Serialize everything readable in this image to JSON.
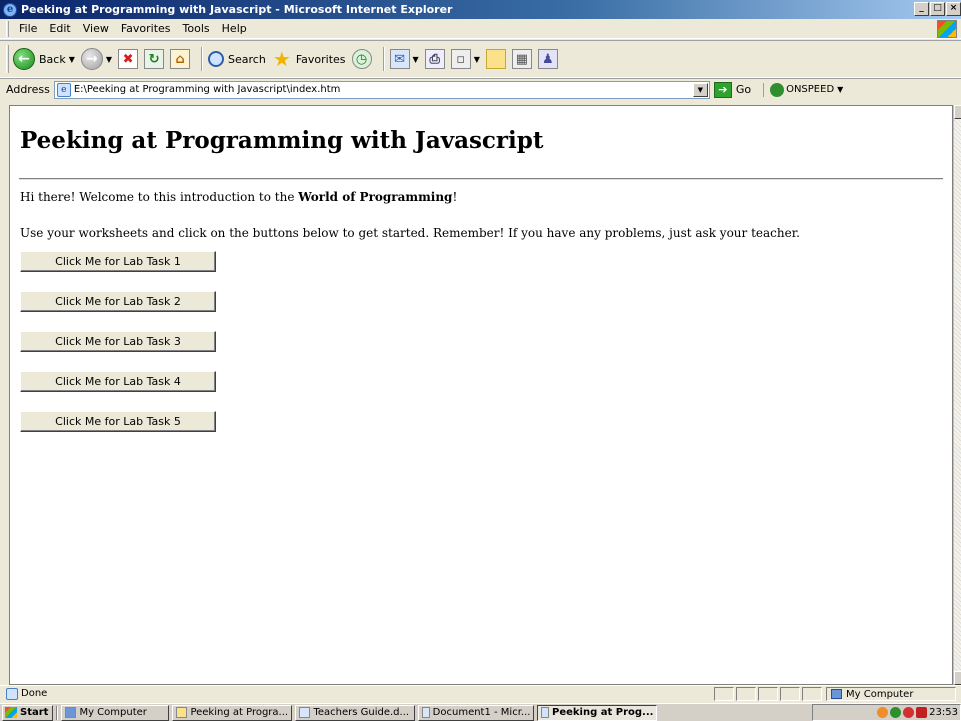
{
  "window": {
    "title": "Peeking at Programming with Javascript - Microsoft Internet Explorer",
    "controls": [
      "_",
      "□",
      "×"
    ]
  },
  "menu": [
    "File",
    "Edit",
    "View",
    "Favorites",
    "Tools",
    "Help"
  ],
  "toolbar": {
    "back_label": "Back",
    "search_label": "Search",
    "favorites_label": "Favorites"
  },
  "address": {
    "label": "Address",
    "value": "E:\\Peeking at Programming with Javascript\\index.htm",
    "go_label": "Go",
    "links_label": "ONSPEED"
  },
  "page": {
    "heading": "Peeking at Programming with Javascript",
    "welcome_prefix": "Hi there! Welcome to this introduction to the ",
    "welcome_bold": "World of Programming",
    "welcome_suffix": "!",
    "instructions": "Use your worksheets and click on the buttons below to get started. Remember! If you have any problems, just ask your teacher.",
    "buttons": [
      "Click Me for Lab Task 1",
      "Click Me for Lab Task 2",
      "Click Me for Lab Task 3",
      "Click Me for Lab Task 4",
      "Click Me for Lab Task 5"
    ]
  },
  "status": {
    "text": "Done",
    "zone": "My Computer"
  },
  "taskbar": {
    "start_label": "Start",
    "tasks": [
      "My Computer",
      "Peeking at Progra...",
      "Teachers Guide.d...",
      "Document1 - Micr...",
      "Peeking at Prog..."
    ],
    "clock": "23:53"
  }
}
